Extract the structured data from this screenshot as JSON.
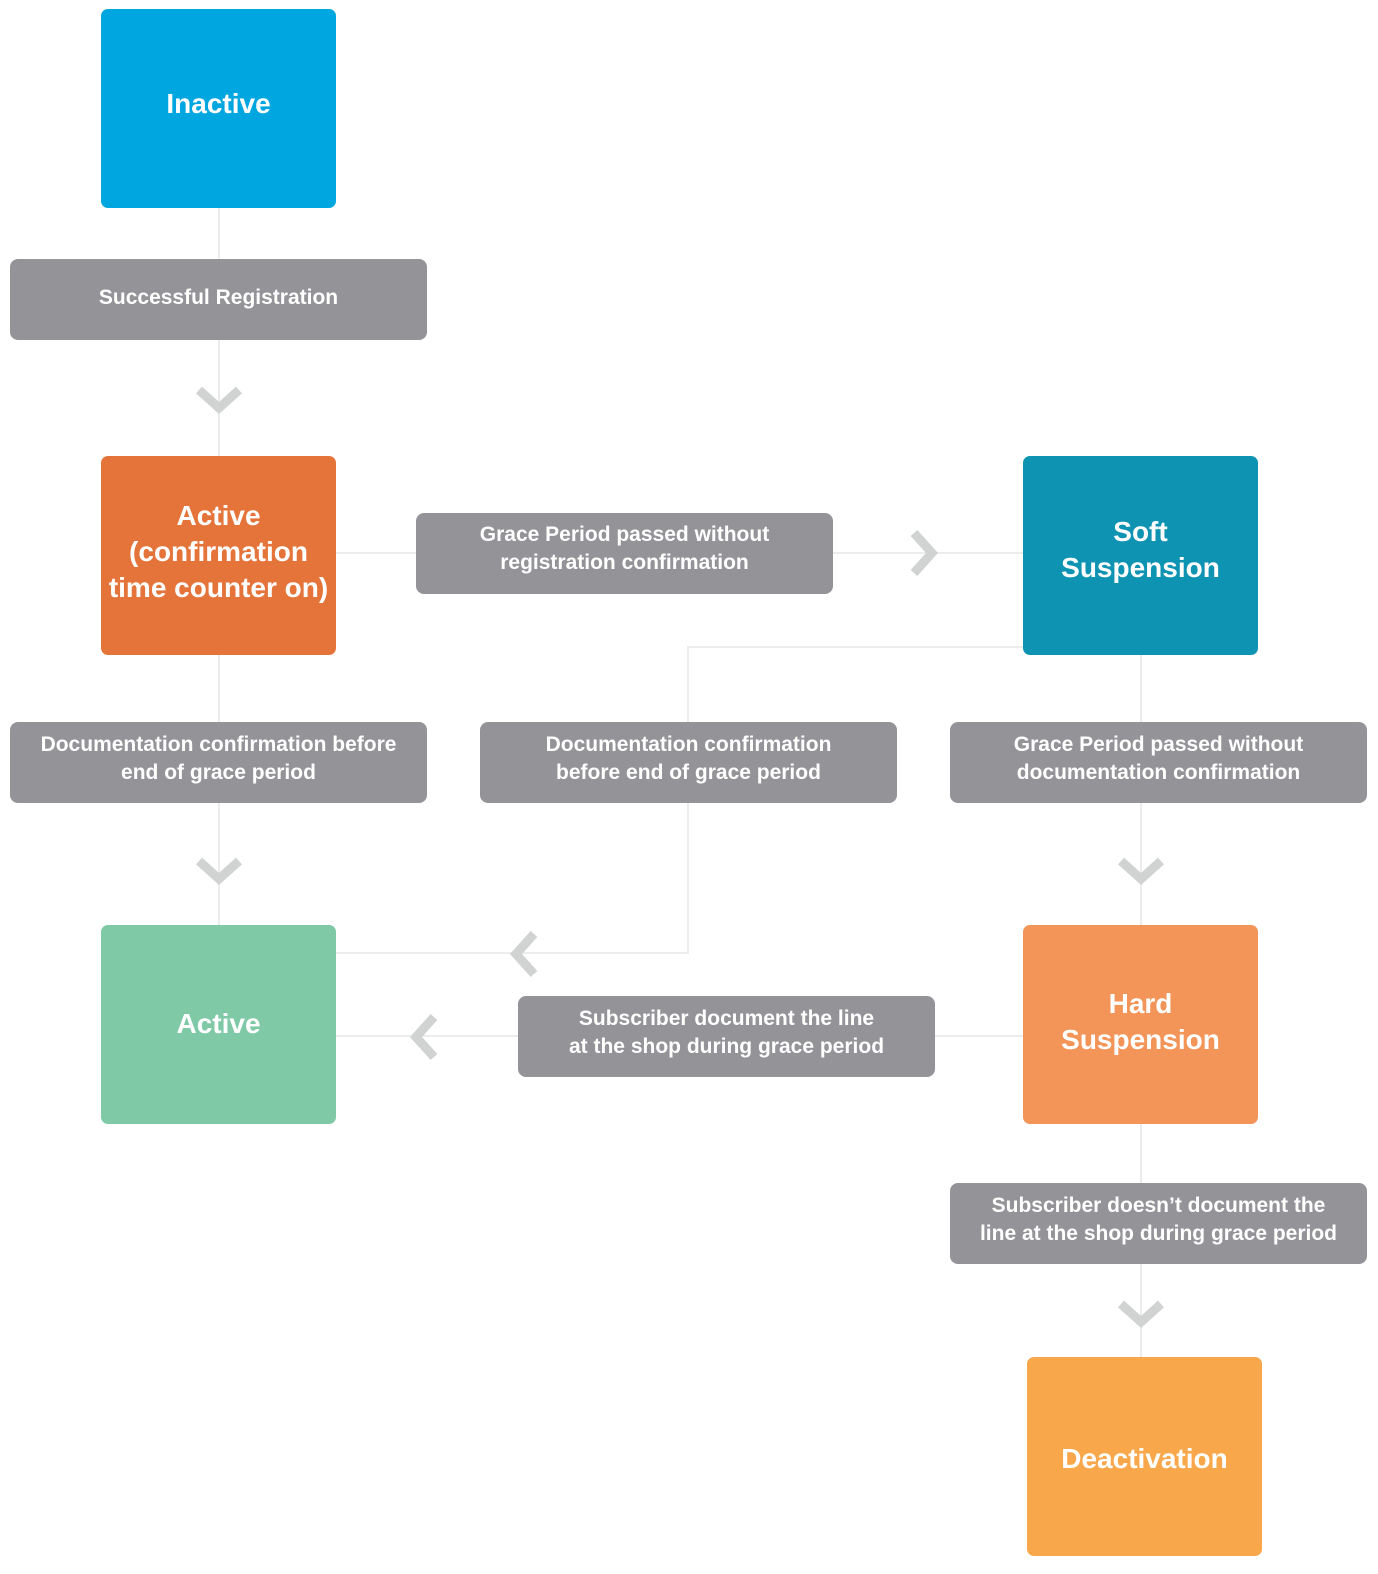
{
  "states": {
    "inactive": {
      "label": "Inactive",
      "color": "#00a6df"
    },
    "active_confirmation": {
      "label": "Active\n(confirmation\ntime counter on)",
      "color": "#e5743a"
    },
    "soft_suspension": {
      "label": "Soft\nSuspension",
      "color": "#0f93b3"
    },
    "active": {
      "label": "Active",
      "color": "#7fc9a7"
    },
    "hard_suspension": {
      "label": "Hard\nSuspension",
      "color": "#f39558"
    },
    "deactivation": {
      "label": "Deactivation",
      "color": "#f9a74b"
    }
  },
  "transitions": {
    "successful_registration": "Successful Registration",
    "grace_no_registration": "Grace Period passed without\nregistration confirmation",
    "doc_confirm_left": "Documentation confirmation before\nend of grace period",
    "doc_confirm_middle": "Documentation confirmation\nbefore end of grace period",
    "grace_no_documentation": "Grace Period passed without\ndocumentation confirmation",
    "subscriber_documents": "Subscriber document the line\nat the shop during grace period",
    "subscriber_not_documents": "Subscriber doesn’t document the\nline at the shop during grace period"
  },
  "colors": {
    "transition_box": "#949398",
    "connector": "#ececec",
    "chevron": "#d1d3d2"
  }
}
